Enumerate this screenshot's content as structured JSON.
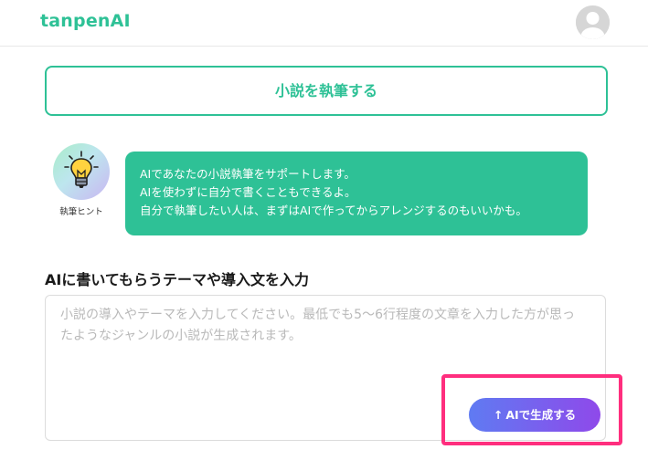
{
  "app": {
    "logo": "tanpenAI"
  },
  "header": {
    "avatar_icon": "user-avatar-icon"
  },
  "main": {
    "write_button_label": "小説を執筆する",
    "hint": {
      "icon": "lightbulb-icon",
      "label": "執筆ヒント",
      "bubble_lines": [
        "AIであなたの小説執筆をサポートします。",
        "AIを使わずに自分で書くこともできるよ。",
        "自分で執筆したい人は、まずはAIで作ってからアレンジするのもいいかも。"
      ]
    },
    "section_title": "AIに書いてもらうテーマや導入文を入力",
    "input": {
      "value": "",
      "placeholder": "小説の導入やテーマを入力してください。最低でも5〜6行程度の文章を入力した方が思ったようなジャンルの小説が生成されます。"
    },
    "generate_button": {
      "icon": "arrow-up-icon",
      "label": "AIで生成する"
    }
  },
  "colors": {
    "brand_green": "#2ec196",
    "button_gradient_start": "#5f7bf2",
    "button_gradient_end": "#8f49ea",
    "highlight": "#ff2e7e"
  }
}
